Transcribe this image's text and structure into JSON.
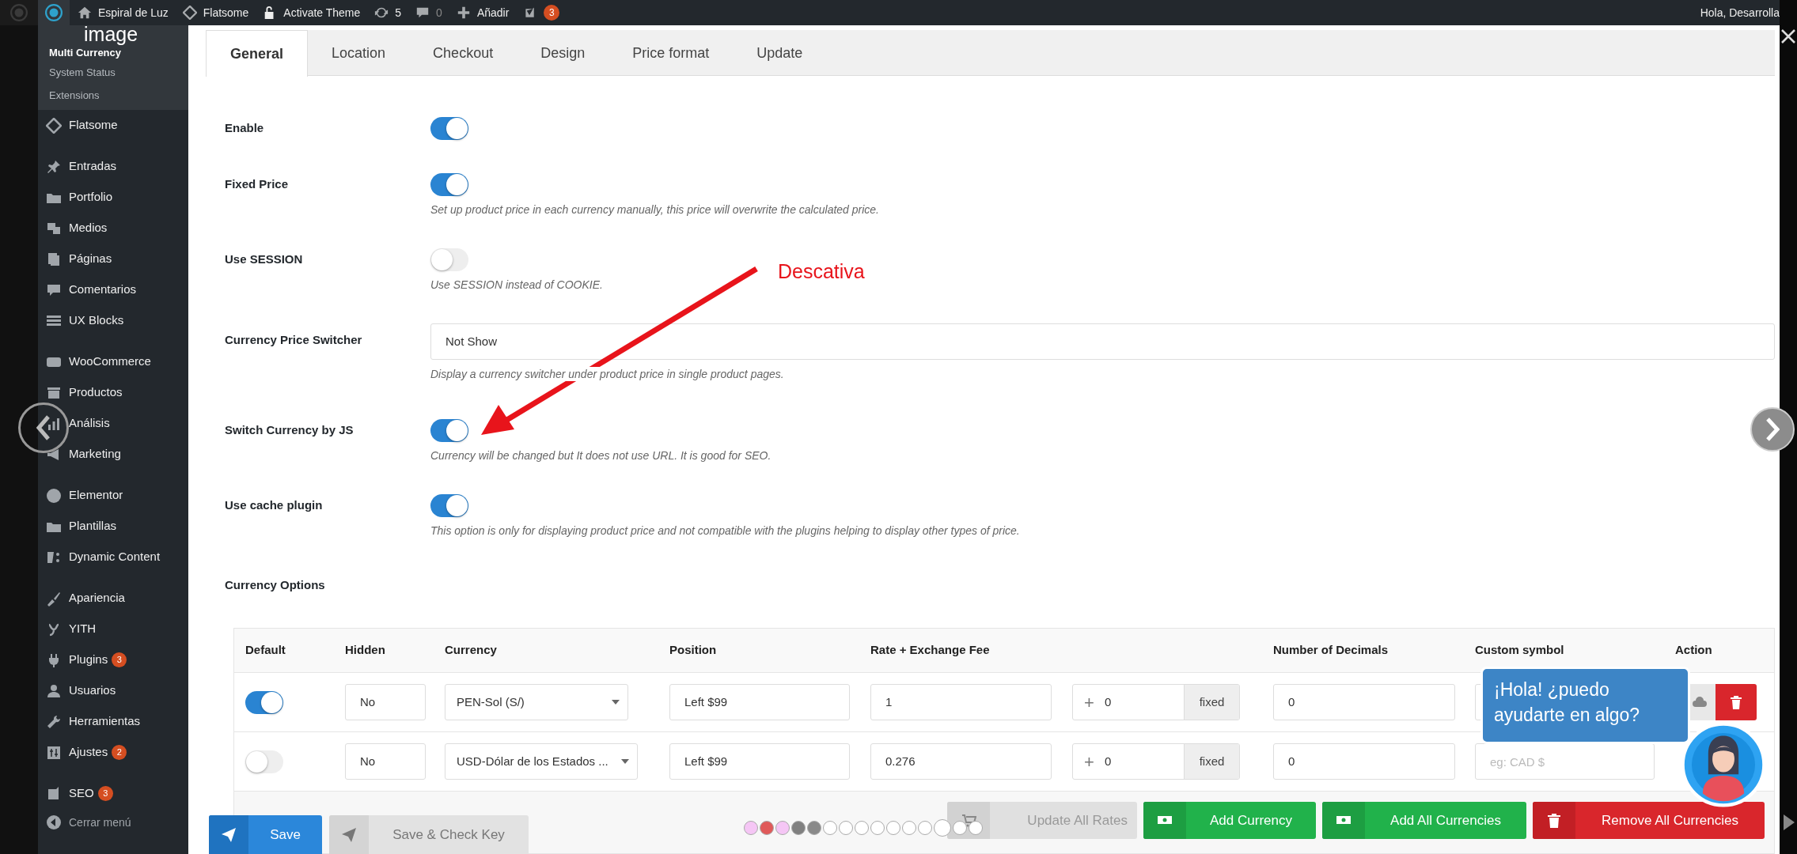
{
  "lightbox": {
    "caption": "image"
  },
  "admin_bar": {
    "items": [
      {
        "kind": "logo"
      },
      {
        "kind": "home",
        "label": "Espiral de Luz"
      },
      {
        "kind": "theme",
        "label": "Flatsome"
      },
      {
        "kind": "lock",
        "label": "Activate Theme"
      },
      {
        "kind": "updates",
        "label": "5"
      },
      {
        "kind": "comments",
        "label": "0"
      },
      {
        "kind": "new",
        "label": "Añadir"
      },
      {
        "kind": "seo",
        "badge": "3"
      }
    ],
    "greeting": "Hola, Desarrolla"
  },
  "sidebar": {
    "submenu": [
      {
        "label": "Multi Currency",
        "selected": true
      },
      {
        "label": "System Status",
        "selected": false
      },
      {
        "label": "Extensions",
        "selected": false
      }
    ],
    "groups": [
      [
        {
          "label": "Flatsome"
        }
      ],
      [
        {
          "label": "Entradas"
        },
        {
          "label": "Portfolio"
        },
        {
          "label": "Medios"
        },
        {
          "label": "Páginas"
        },
        {
          "label": "Comentarios"
        },
        {
          "label": "UX Blocks"
        }
      ],
      [
        {
          "label": "WooCommerce"
        },
        {
          "label": "Productos"
        },
        {
          "label": "Análisis"
        },
        {
          "label": "Marketing"
        }
      ],
      [
        {
          "label": "Elementor"
        },
        {
          "label": "Plantillas"
        },
        {
          "label": "Dynamic Content"
        }
      ],
      [
        {
          "label": "Apariencia"
        },
        {
          "label": "YITH"
        },
        {
          "label": "Plugins",
          "badge": "3"
        },
        {
          "label": "Usuarios"
        },
        {
          "label": "Herramientas"
        },
        {
          "label": "Ajustes",
          "badge": "2"
        }
      ],
      [
        {
          "label": "SEO",
          "badge": "3"
        }
      ]
    ],
    "collapse_label": "Cerrar menú"
  },
  "tabs": [
    {
      "label": "General",
      "selected": true
    },
    {
      "label": "Location",
      "selected": false
    },
    {
      "label": "Checkout",
      "selected": false
    },
    {
      "label": "Design",
      "selected": false
    },
    {
      "label": "Price format",
      "selected": false
    },
    {
      "label": "Update",
      "selected": false
    }
  ],
  "settings": [
    {
      "kind": "toggle",
      "label": "Enable",
      "on": true
    },
    {
      "kind": "toggle",
      "label": "Fixed Price",
      "on": true,
      "description": "Set up product price in each currency manually, this price will overwrite the calculated price."
    },
    {
      "kind": "toggle",
      "label": "Use SESSION",
      "on": false,
      "description": "Use SESSION instead of COOKIE."
    },
    {
      "kind": "select",
      "label": "Currency Price Switcher",
      "value": "Not Show",
      "description": "Display a currency switcher under product price in single product pages."
    },
    {
      "kind": "toggle",
      "label": "Switch Currency by JS",
      "on": true,
      "description": "Currency will be changed but It does not use URL. It is good for SEO."
    },
    {
      "kind": "toggle",
      "label": "Use cache plugin",
      "on": true,
      "description": "This option is only for displaying product price and not compatible with the plugins helping to display other types of price."
    },
    {
      "kind": "heading",
      "label": "Currency Options"
    }
  ],
  "annotation": {
    "text": "Descativa"
  },
  "currency_table": {
    "columns": [
      "Default",
      "Hidden",
      "Currency",
      "Position",
      "Rate + Exchange Fee",
      "Number of Decimals",
      "Custom symbol",
      "Action"
    ],
    "rows": [
      {
        "default": true,
        "hidden": "No",
        "currency": "PEN-Sol (S/)",
        "position": "Left $99",
        "rate": "1",
        "fee_sign": "+",
        "fee": "0",
        "fee_type": "fixed",
        "decimals": "0",
        "actions_visible": true
      },
      {
        "default": false,
        "hidden": "No",
        "currency": "USD-Dólar de los Estados ...",
        "position": "Left $99",
        "rate": "0.276",
        "fee_sign": "+",
        "fee": "0",
        "fee_type": "fixed",
        "decimals": "0",
        "custom_symbol_placeholder": "eg: CAD $",
        "actions_visible": false
      }
    ],
    "buttons": [
      {
        "kind": "update",
        "label": "Update All Rates"
      },
      {
        "kind": "add",
        "label": "Add Currency"
      },
      {
        "kind": "add_all",
        "label": "Add All Currencies"
      },
      {
        "kind": "remove",
        "label": "Remove All Currencies"
      }
    ]
  },
  "save_buttons": [
    {
      "kind": "save",
      "label": "Save"
    },
    {
      "kind": "check",
      "label": "Save & Check Key"
    }
  ],
  "chat": {
    "message": "¡Hola! ¿puedo ayudarte en algo?"
  },
  "slide_dots": [
    {
      "color": "#f5c6f5",
      "selected": false
    },
    {
      "color": "#e05a5a",
      "selected": false
    },
    {
      "color": "#f5c6f5",
      "selected": false
    },
    {
      "color": "#808080",
      "selected": false
    },
    {
      "color": "#8a8a8a",
      "selected": false
    },
    {
      "color": "#ffffff",
      "selected": false
    },
    {
      "color": "#ffffff",
      "selected": false
    },
    {
      "color": "#ffffff",
      "selected": false
    },
    {
      "color": "#ffffff",
      "selected": false
    },
    {
      "color": "#ffffff",
      "selected": false
    },
    {
      "color": "#ffffff",
      "selected": false
    },
    {
      "color": "#ffffff",
      "selected": false
    },
    {
      "color": "#ffffff",
      "selected": true
    },
    {
      "color": "#ffffff",
      "selected": false
    },
    {
      "color": "#ffffff",
      "selected": false
    }
  ]
}
